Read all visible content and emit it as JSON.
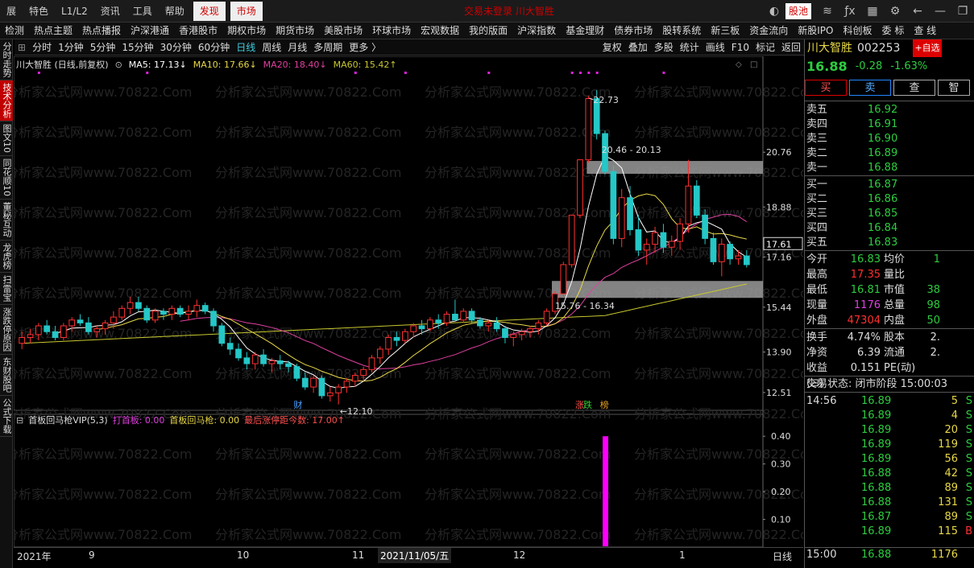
{
  "menu": {
    "items": [
      "展",
      "特色",
      "L1/L2",
      "资讯",
      "工具",
      "帮助"
    ],
    "highlight": [
      "发现",
      "市场"
    ],
    "title_center": "交易未登录  川大智胜",
    "gu_pool": "股池"
  },
  "nav": {
    "items": [
      "检测",
      "热点主题",
      "热点播报",
      "沪深港通",
      "香港股市",
      "期权市场",
      "期货市场",
      "美股市场",
      "环球市场",
      "宏观数据",
      "我的版面",
      "沪深指数",
      "基金理财",
      "债券市场",
      "股转系统",
      "新三板",
      "资金流向",
      "新股IPO",
      "科创板",
      "委 标",
      "查 线"
    ]
  },
  "toolbar": {
    "periods": [
      "分时",
      "1分钟",
      "5分钟",
      "15分钟",
      "30分钟",
      "60分钟",
      "日线",
      "周线",
      "月线",
      "多周期",
      "更多 〉"
    ],
    "active": "日线",
    "right": [
      "复权",
      "叠加",
      "多股",
      "统计",
      "画线",
      "F10",
      "标记",
      "返回"
    ]
  },
  "leftbar": {
    "items": [
      "分时走势",
      "技术分析",
      "图文10",
      "同花顺10",
      "董秘互动",
      "龙虎榜",
      "扫雷宝",
      "涨跌停原因",
      "东财股吧",
      "公式下载"
    ],
    "active": "技术分析"
  },
  "legend": {
    "title": "川大智胜 (日线,前复权)",
    "ma5": "MA5: 17.13↓",
    "ma10": "MA10: 17.66↓",
    "ma20": "MA20: 18.40↓",
    "ma60": "MA60: 15.42↑"
  },
  "indicator": {
    "title": "首板回马枪VIP(5,3)",
    "a": "打首板: 0.00",
    "b": "首板回马枪: 0.00",
    "c": "最后涨停距今数: 17.00↑"
  },
  "axis": {
    "price": [
      "20.76",
      "18.88",
      "17.16",
      "15.44",
      "13.90",
      "12.51"
    ],
    "current": "17.61",
    "ind": [
      "0.40",
      "0.30",
      "0.20",
      "0.10"
    ],
    "x": [
      "2021年",
      "9",
      "10",
      "11",
      "2021/11/05/五",
      "12",
      "1"
    ],
    "period": "日线"
  },
  "annotations": {
    "high": "22.73",
    "low": "12.10",
    "zone_top": "20.46 - 20.13",
    "zone_bot": "15.76 - 16.34",
    "cai": "财",
    "zhang": "涨",
    "die": "跌",
    "bang": "榜",
    "watermark": "分析家公式网www.70822.Com"
  },
  "quote": {
    "name": "川大智胜",
    "code": "002253",
    "price": "16.88",
    "chg": "-0.28",
    "pct": "-1.63%",
    "add": "+自选",
    "btns": [
      "买",
      "卖",
      "查",
      "智"
    ],
    "asks": [
      [
        "卖五",
        "16.92"
      ],
      [
        "卖四",
        "16.91"
      ],
      [
        "卖三",
        "16.90"
      ],
      [
        "卖二",
        "16.89"
      ],
      [
        "卖一",
        "16.88"
      ]
    ],
    "bids": [
      [
        "买一",
        "16.87"
      ],
      [
        "买二",
        "16.86"
      ],
      [
        "买三",
        "16.85"
      ],
      [
        "买四",
        "16.84"
      ],
      [
        "买五",
        "16.83"
      ]
    ],
    "stats": [
      [
        "今开",
        "16.83",
        "均价",
        "1"
      ],
      [
        "最高",
        "17.35",
        "量比",
        ""
      ],
      [
        "最低",
        "16.81",
        "市值",
        "38"
      ],
      [
        "现量",
        "1176",
        "总量",
        "98"
      ],
      [
        "外盘",
        "47304",
        "内盘",
        "50"
      ]
    ],
    "stats2": [
      [
        "换手",
        "4.74%",
        "股本",
        "2."
      ],
      [
        "净资",
        "6.39",
        "流通",
        "2."
      ],
      [
        "收益(⊟)",
        "0.151",
        "PE(动)",
        ""
      ]
    ],
    "status": "交易状态: 闭市阶段 15:00:03",
    "ticks": [
      [
        "14:56",
        "16.89",
        "5",
        "S"
      ],
      [
        "",
        "16.89",
        "4",
        "S"
      ],
      [
        "",
        "16.89",
        "20",
        "S"
      ],
      [
        "",
        "16.89",
        "119",
        "S"
      ],
      [
        "",
        "16.89",
        "56",
        "S"
      ],
      [
        "",
        "16.88",
        "42",
        "S"
      ],
      [
        "",
        "16.88",
        "89",
        "S"
      ],
      [
        "",
        "16.88",
        "131",
        "S"
      ],
      [
        "",
        "16.87",
        "89",
        "S"
      ],
      [
        "",
        "16.89",
        "115",
        "B"
      ]
    ],
    "last": [
      "15:00",
      "16.88",
      "1176"
    ]
  },
  "colors": {
    "up": "#ff3030",
    "down": "#25c7c7",
    "ma5": "#ffffff",
    "ma10": "#e8d848",
    "ma20": "#e040a0",
    "ma60": "#c8c830"
  },
  "chart_data": {
    "type": "candlestick",
    "ohlc": [
      [
        14.2,
        14.6,
        14.0,
        14.4
      ],
      [
        14.4,
        14.7,
        14.2,
        14.5
      ],
      [
        14.5,
        14.9,
        14.3,
        14.8
      ],
      [
        14.8,
        15.0,
        14.5,
        14.6
      ],
      [
        14.6,
        14.8,
        14.3,
        14.4
      ],
      [
        14.4,
        14.9,
        14.3,
        14.8
      ],
      [
        14.8,
        15.1,
        14.6,
        15.0
      ],
      [
        15.0,
        15.2,
        14.8,
        14.9
      ],
      [
        14.9,
        15.1,
        14.5,
        14.6
      ],
      [
        14.6,
        14.8,
        14.4,
        14.7
      ],
      [
        14.7,
        15.0,
        14.5,
        14.9
      ],
      [
        14.9,
        15.3,
        14.7,
        15.1
      ],
      [
        15.1,
        15.5,
        15.0,
        15.4
      ],
      [
        15.4,
        15.8,
        15.2,
        15.6
      ],
      [
        15.6,
        15.8,
        15.3,
        15.4
      ],
      [
        15.4,
        15.5,
        14.9,
        15.0
      ],
      [
        15.0,
        15.4,
        14.9,
        15.3
      ],
      [
        15.3,
        15.4,
        15.0,
        15.2
      ],
      [
        15.2,
        15.5,
        15.0,
        15.4
      ],
      [
        15.4,
        15.5,
        15.1,
        15.2
      ],
      [
        15.2,
        15.5,
        15.0,
        15.3
      ],
      [
        15.3,
        15.7,
        15.1,
        15.5
      ],
      [
        15.5,
        15.6,
        15.2,
        15.3
      ],
      [
        15.3,
        15.4,
        14.6,
        14.8
      ],
      [
        14.8,
        14.9,
        14.1,
        14.2
      ],
      [
        14.2,
        14.4,
        13.8,
        14.0
      ],
      [
        14.0,
        14.2,
        13.6,
        13.7
      ],
      [
        13.7,
        13.9,
        13.3,
        13.5
      ],
      [
        13.5,
        13.9,
        13.3,
        13.8
      ],
      [
        13.8,
        14.0,
        13.4,
        13.5
      ],
      [
        13.5,
        13.7,
        13.2,
        13.6
      ],
      [
        13.6,
        13.8,
        13.3,
        13.5
      ],
      [
        13.5,
        13.6,
        13.2,
        13.4
      ],
      [
        13.4,
        13.5,
        12.9,
        13.0
      ],
      [
        13.0,
        13.2,
        12.6,
        12.7
      ],
      [
        12.7,
        13.1,
        12.5,
        13.0
      ],
      [
        13.0,
        13.1,
        12.3,
        12.4
      ],
      [
        12.4,
        12.7,
        12.2,
        12.5
      ],
      [
        12.5,
        12.8,
        12.1,
        12.7
      ],
      [
        12.7,
        13.0,
        12.5,
        12.9
      ],
      [
        12.9,
        13.2,
        12.7,
        13.1
      ],
      [
        13.1,
        13.4,
        12.9,
        13.3
      ],
      [
        13.3,
        13.8,
        13.2,
        13.7
      ],
      [
        13.7,
        14.1,
        13.5,
        14.0
      ],
      [
        14.0,
        14.5,
        13.8,
        14.4
      ],
      [
        14.4,
        14.6,
        14.1,
        14.3
      ],
      [
        14.3,
        14.7,
        14.2,
        14.6
      ],
      [
        14.6,
        14.9,
        14.4,
        14.8
      ],
      [
        14.8,
        15.0,
        14.5,
        14.7
      ],
      [
        14.7,
        15.1,
        14.6,
        15.0
      ],
      [
        15.0,
        15.2,
        14.7,
        14.9
      ],
      [
        14.9,
        15.3,
        14.8,
        15.2
      ],
      [
        15.2,
        15.7,
        15.1,
        15.0
      ],
      [
        15.0,
        15.4,
        14.9,
        15.3
      ],
      [
        15.3,
        15.4,
        14.9,
        15.0
      ],
      [
        15.0,
        15.1,
        14.7,
        14.8
      ],
      [
        14.8,
        15.0,
        14.6,
        14.9
      ],
      [
        14.9,
        15.1,
        14.6,
        14.7
      ],
      [
        14.7,
        14.8,
        14.2,
        14.4
      ],
      [
        14.4,
        14.6,
        14.1,
        14.5
      ],
      [
        14.5,
        14.7,
        14.3,
        14.6
      ],
      [
        14.6,
        14.8,
        14.4,
        14.7
      ],
      [
        14.7,
        15.0,
        14.5,
        14.9
      ],
      [
        14.9,
        15.4,
        14.8,
        15.3
      ],
      [
        15.3,
        16.0,
        15.2,
        15.9
      ],
      [
        15.9,
        17.0,
        15.8,
        16.9
      ],
      [
        16.9,
        18.6,
        16.8,
        18.6
      ],
      [
        18.6,
        20.5,
        18.5,
        20.5
      ],
      [
        20.5,
        22.7,
        20.4,
        22.6
      ],
      [
        22.6,
        22.9,
        21.2,
        21.4
      ],
      [
        21.4,
        21.5,
        20.0,
        20.1
      ],
      [
        20.1,
        20.3,
        17.6,
        17.8
      ],
      [
        17.8,
        19.5,
        17.5,
        19.2
      ],
      [
        19.2,
        19.6,
        17.9,
        18.1
      ],
      [
        18.1,
        18.6,
        17.2,
        17.4
      ],
      [
        17.4,
        17.8,
        16.9,
        17.6
      ],
      [
        17.6,
        18.2,
        17.3,
        18.0
      ],
      [
        18.0,
        18.3,
        17.3,
        17.5
      ],
      [
        17.5,
        17.9,
        17.2,
        17.7
      ],
      [
        17.7,
        18.5,
        17.4,
        18.3
      ],
      [
        18.3,
        20.5,
        18.0,
        19.6
      ],
      [
        19.6,
        19.8,
        18.5,
        18.6
      ],
      [
        18.6,
        18.8,
        17.6,
        17.8
      ],
      [
        17.8,
        18.0,
        16.9,
        17.0
      ],
      [
        17.0,
        17.8,
        16.5,
        17.6
      ],
      [
        17.6,
        17.7,
        16.9,
        17.1
      ],
      [
        17.1,
        17.4,
        16.9,
        17.2
      ],
      [
        17.2,
        17.4,
        16.8,
        16.9
      ]
    ],
    "ma5_end": 17.13,
    "ma10_end": 17.66,
    "ma20_end": 18.4,
    "ma60_end": 15.42,
    "ylim": [
      11.9,
      23.5
    ],
    "indicator_bar": {
      "index": 70,
      "value": 0.4
    },
    "ind_ylim": [
      0,
      0.45
    ]
  }
}
